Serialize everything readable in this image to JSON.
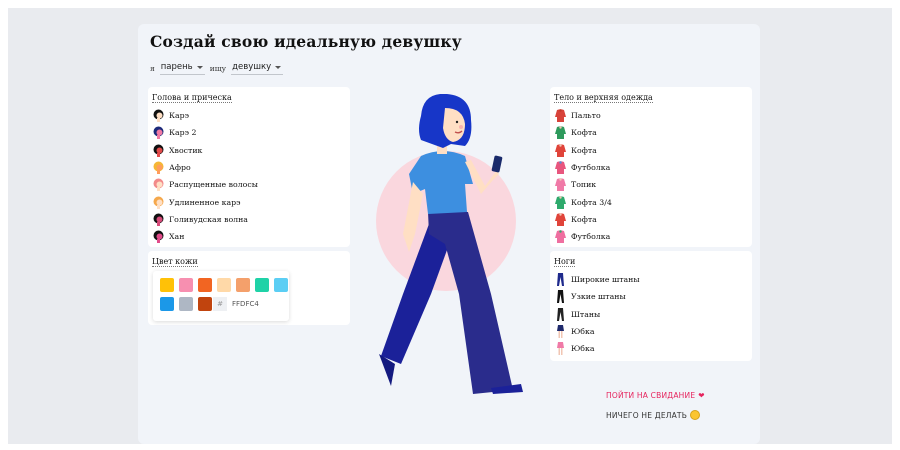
{
  "title": "Создай свою идеальную девушку",
  "filter": {
    "prefix": "я",
    "gender_value": "парень",
    "mid": "ищу",
    "target_value": "девушку"
  },
  "head_panel": {
    "title": "Голова и прическа",
    "items": [
      {
        "label": "Карэ",
        "icon": "hair-bob-icon"
      },
      {
        "label": "Карэ 2",
        "icon": "hair-bob-2-icon"
      },
      {
        "label": "Хвостик",
        "icon": "ponytail-icon"
      },
      {
        "label": "Афро",
        "icon": "afro-icon"
      },
      {
        "label": "Распущенные волосы",
        "icon": "loose-hair-icon"
      },
      {
        "label": "Удлиненное карэ",
        "icon": "long-bob-icon"
      },
      {
        "label": "Голивудская волна",
        "icon": "hollywood-wave-icon"
      },
      {
        "label": "Хан",
        "icon": "bun-icon"
      }
    ]
  },
  "skin_panel": {
    "title": "Цвет кожи",
    "colors": [
      "#FFC107",
      "#F78FB0",
      "#F26522",
      "#FFD9A8",
      "#F4A06B",
      "#1FD2A7",
      "#5BCEF4",
      "#1B98E8",
      "#AEB7C4",
      "#C1440E"
    ],
    "hash": "#",
    "hex_value": "FFDFC4"
  },
  "body_panel": {
    "title": "Тело и верхняя одежда",
    "items": [
      {
        "label": "Пальто",
        "icon": "coat-icon"
      },
      {
        "label": "Кофта",
        "icon": "sweater-icon"
      },
      {
        "label": "Кофта",
        "icon": "sweater-red-icon"
      },
      {
        "label": "Футболка",
        "icon": "tshirt-icon"
      },
      {
        "label": "Топик",
        "icon": "top-icon"
      },
      {
        "label": "Кофта 3/4",
        "icon": "sweater-34-icon"
      },
      {
        "label": "Кофта",
        "icon": "sweater-red-2-icon"
      },
      {
        "label": "Футболка",
        "icon": "tshirt-2-icon"
      }
    ]
  },
  "legs_panel": {
    "title": "Ноги",
    "items": [
      {
        "label": "Широкие штаны",
        "icon": "wide-pants-icon"
      },
      {
        "label": "Узкие штаны",
        "icon": "skinny-pants-icon"
      },
      {
        "label": "Штаны",
        "icon": "pants-icon"
      },
      {
        "label": "Юбка",
        "icon": "skirt-icon"
      },
      {
        "label": "Юбка",
        "icon": "skirt-2-icon"
      }
    ]
  },
  "actions": {
    "date_label": "ПОЙТИ НА СВИДАНИЕ",
    "date_color": "#E6245E",
    "date_emoji": "❤",
    "nothing_label": "НИЧЕГО НЕ ДЕЛАТЬ",
    "nothing_emoji": "🙂"
  },
  "figure": {
    "hair": "#1736C8",
    "shirt": "#3D8FE0",
    "pants": "#2A2C8C",
    "skin": "#FFDFC4",
    "bg_circle": "#FAD7DE",
    "shoes": "#1B2199"
  }
}
